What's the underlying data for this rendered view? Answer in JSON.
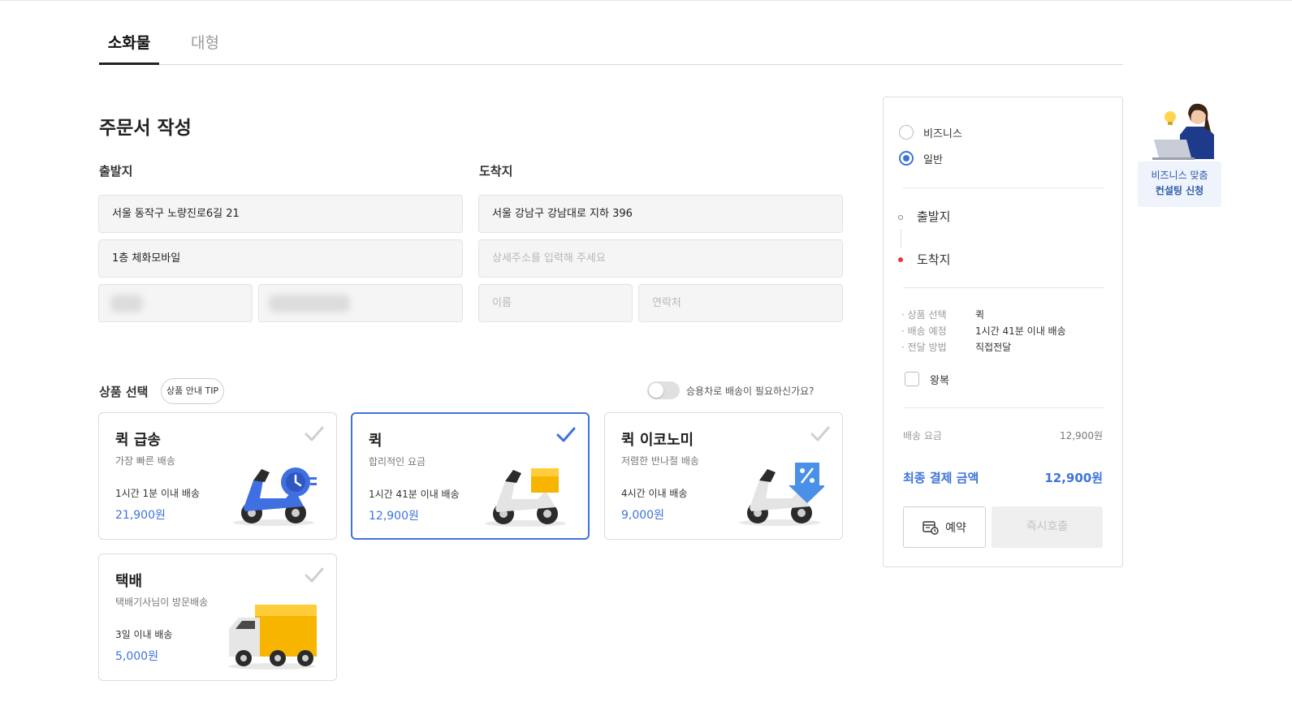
{
  "tabs": [
    {
      "label": "소화물",
      "active": true
    },
    {
      "label": "대형",
      "active": false
    }
  ],
  "page_title": "주문서 작성",
  "origin": {
    "label": "출발지",
    "address": "서울 동작구 노량진로6길 21",
    "detail": "1층 체화모바일"
  },
  "destination": {
    "label": "도착지",
    "address": "서울 강남구 강남대로 지하 396",
    "detail_placeholder": "상세주소를 입력해 주세요",
    "name_placeholder": "이름",
    "phone_placeholder": "연락처"
  },
  "products": {
    "title": "상품 선택",
    "tip_label": "상품 안내 TIP",
    "car_toggle_label": "승용차로 배송이 필요하신가요?",
    "car_toggle_on": false,
    "items": [
      {
        "name": "퀵 급송",
        "desc": "가장 빠른 배송",
        "time": "1시간 1분 이내 배송",
        "price": "21,900원",
        "selected": false,
        "icon": "scooter-timer-icon"
      },
      {
        "name": "퀵",
        "desc": "합리적인 요금",
        "time": "1시간 41분 이내 배송",
        "price": "12,900원",
        "selected": true,
        "icon": "scooter-box-icon"
      },
      {
        "name": "퀵 이코노미",
        "desc": "저렴한 반나절 배송",
        "time": "4시간 이내 배송",
        "price": "9,000원",
        "selected": false,
        "icon": "scooter-discount-icon"
      },
      {
        "name": "택배",
        "desc": "택배기사님이 방문배송",
        "time": "3일 이내 배송",
        "price": "5,000원",
        "selected": false,
        "icon": "delivery-truck-icon"
      }
    ]
  },
  "summary": {
    "customer_types": [
      {
        "label": "비즈니스",
        "selected": false
      },
      {
        "label": "일반",
        "selected": true
      }
    ],
    "route": {
      "origin_label": "출발지",
      "destination_label": "도착지"
    },
    "info": [
      {
        "key": "· 상품 선택",
        "value": "퀵"
      },
      {
        "key": "· 배송 예정",
        "value": "1시간 41분 이내 배송"
      },
      {
        "key": "· 전달 방법",
        "value": "직접전달"
      }
    ],
    "round_trip_label": "왕복",
    "round_trip_checked": false,
    "fee_label": "배송 요금",
    "fee_value": "12,900원",
    "total_label": "최종 결제 금액",
    "total_value": "12,900원",
    "reserve_label": "예약",
    "call_label": "즉시호출"
  },
  "consulting": {
    "line1": "비즈니스 맞춤",
    "line2": "컨설팅 신청"
  },
  "colors": {
    "accent": "#3d74db",
    "origin_dot": "#888888",
    "destination_dot": "#e53935",
    "field_bg": "#f5f5f5"
  }
}
